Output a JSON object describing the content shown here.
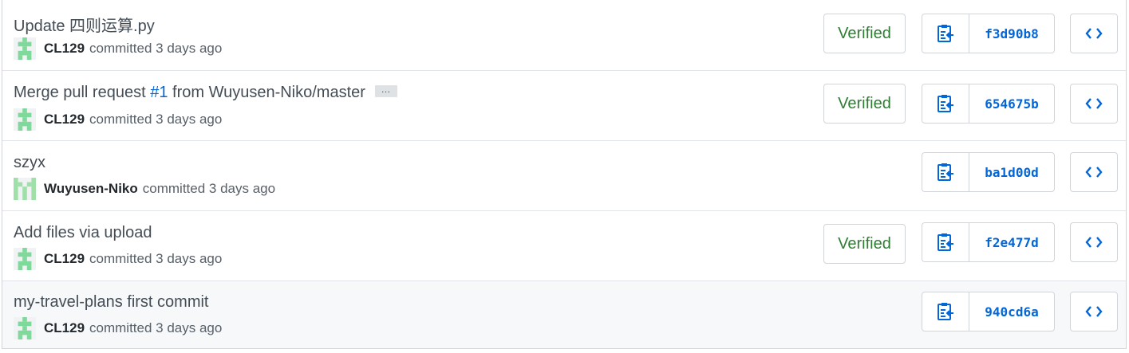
{
  "colors": {
    "link": "#0366d6",
    "verified": "#2e7d32",
    "identicon_green": "#7fd99a"
  },
  "commits": [
    {
      "message": "Update 四则运算.py",
      "author": "CL129",
      "meta": "committed 3 days ago",
      "verified": "Verified",
      "sha": "f3d90b8",
      "avatar_icon": "identicon-cl129-icon"
    },
    {
      "message_prefix": "Merge pull request ",
      "pr_link": "#1",
      "message_suffix": " from Wuyusen-Niko/master",
      "ellipsis": "…",
      "author": "CL129",
      "meta": "committed 3 days ago",
      "verified": "Verified",
      "sha": "654675b",
      "avatar_icon": "identicon-cl129-icon"
    },
    {
      "message": "szyx",
      "author": "Wuyusen-Niko",
      "meta": "committed 3 days ago",
      "sha": "ba1d00d",
      "avatar_icon": "identicon-wuyusen-icon"
    },
    {
      "message": "Add files via upload",
      "author": "CL129",
      "meta": "committed 3 days ago",
      "verified": "Verified",
      "sha": "f2e477d",
      "avatar_icon": "identicon-cl129-icon"
    },
    {
      "message": "my-travel-plans first commit",
      "author": "CL129",
      "meta": "committed 3 days ago",
      "sha": "940cd6a",
      "avatar_icon": "identicon-cl129-icon"
    }
  ]
}
